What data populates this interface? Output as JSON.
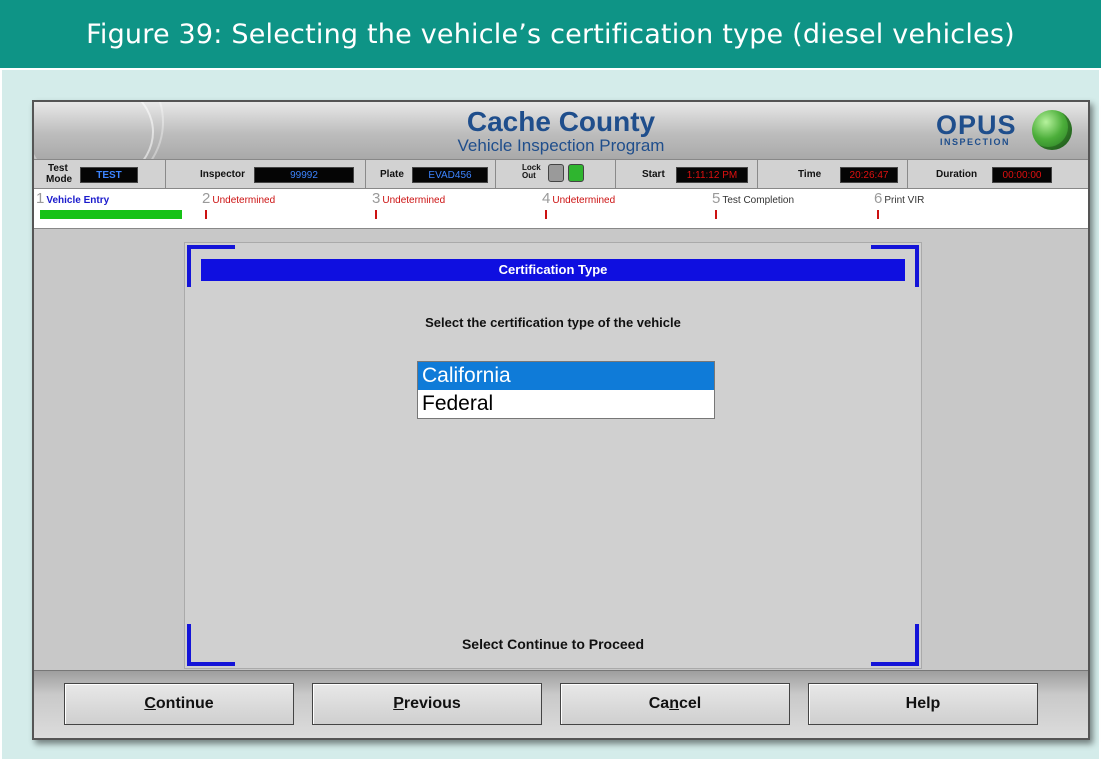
{
  "figure": {
    "caption": "Figure 39: Selecting the vehicle’s certification type (diesel vehicles)"
  },
  "app": {
    "title": "Cache County",
    "subtitle": "Vehicle Inspection Program",
    "logo": {
      "name": "OPUS",
      "sub": "INSPECTION",
      "icon": "globe-icon"
    }
  },
  "status": {
    "test_mode_label_1": "Test",
    "test_mode_label_2": "Mode",
    "test_mode_value": "TEST",
    "inspector_label": "Inspector",
    "inspector_value": "99992",
    "plate_label": "Plate",
    "plate_value": "EVAD456",
    "lockout_label_1": "Lock",
    "lockout_label_2": "Out",
    "start_label": "Start",
    "start_value": "1:11:12 PM",
    "time_label": "Time",
    "time_value": "20:26:47",
    "duration_label": "Duration",
    "duration_value": "00:00:00"
  },
  "steps": [
    {
      "num": "1",
      "label": "Vehicle Entry",
      "color": "#1a1acc"
    },
    {
      "num": "2",
      "label": "Undetermined",
      "color": "#cc1111"
    },
    {
      "num": "3",
      "label": "Undetermined",
      "color": "#cc1111"
    },
    {
      "num": "4",
      "label": "Undetermined",
      "color": "#cc1111"
    },
    {
      "num": "5",
      "label": "Test Completion",
      "color": "#333333"
    },
    {
      "num": "6",
      "label": "Print VIR",
      "color": "#333333"
    }
  ],
  "certification": {
    "header": "Certification Type",
    "prompt": "Select the certification type of the vehicle",
    "options": [
      {
        "label": "California",
        "selected": true
      },
      {
        "label": "Federal",
        "selected": false
      }
    ],
    "footer": "Select Continue to Proceed"
  },
  "buttons": {
    "continue": {
      "first": "C",
      "rest": "ontinue"
    },
    "previous": {
      "first": "P",
      "rest": "revious"
    },
    "cancel": {
      "pre": "Ca",
      "mid": "n",
      "post": "cel"
    },
    "help": "Help"
  },
  "colors": {
    "banner": "#0e9486",
    "app_title": "#1f4e8c",
    "cert_header": "#0f0fe0",
    "selected_option": "#0f7bd8",
    "progress": "#16c216"
  }
}
